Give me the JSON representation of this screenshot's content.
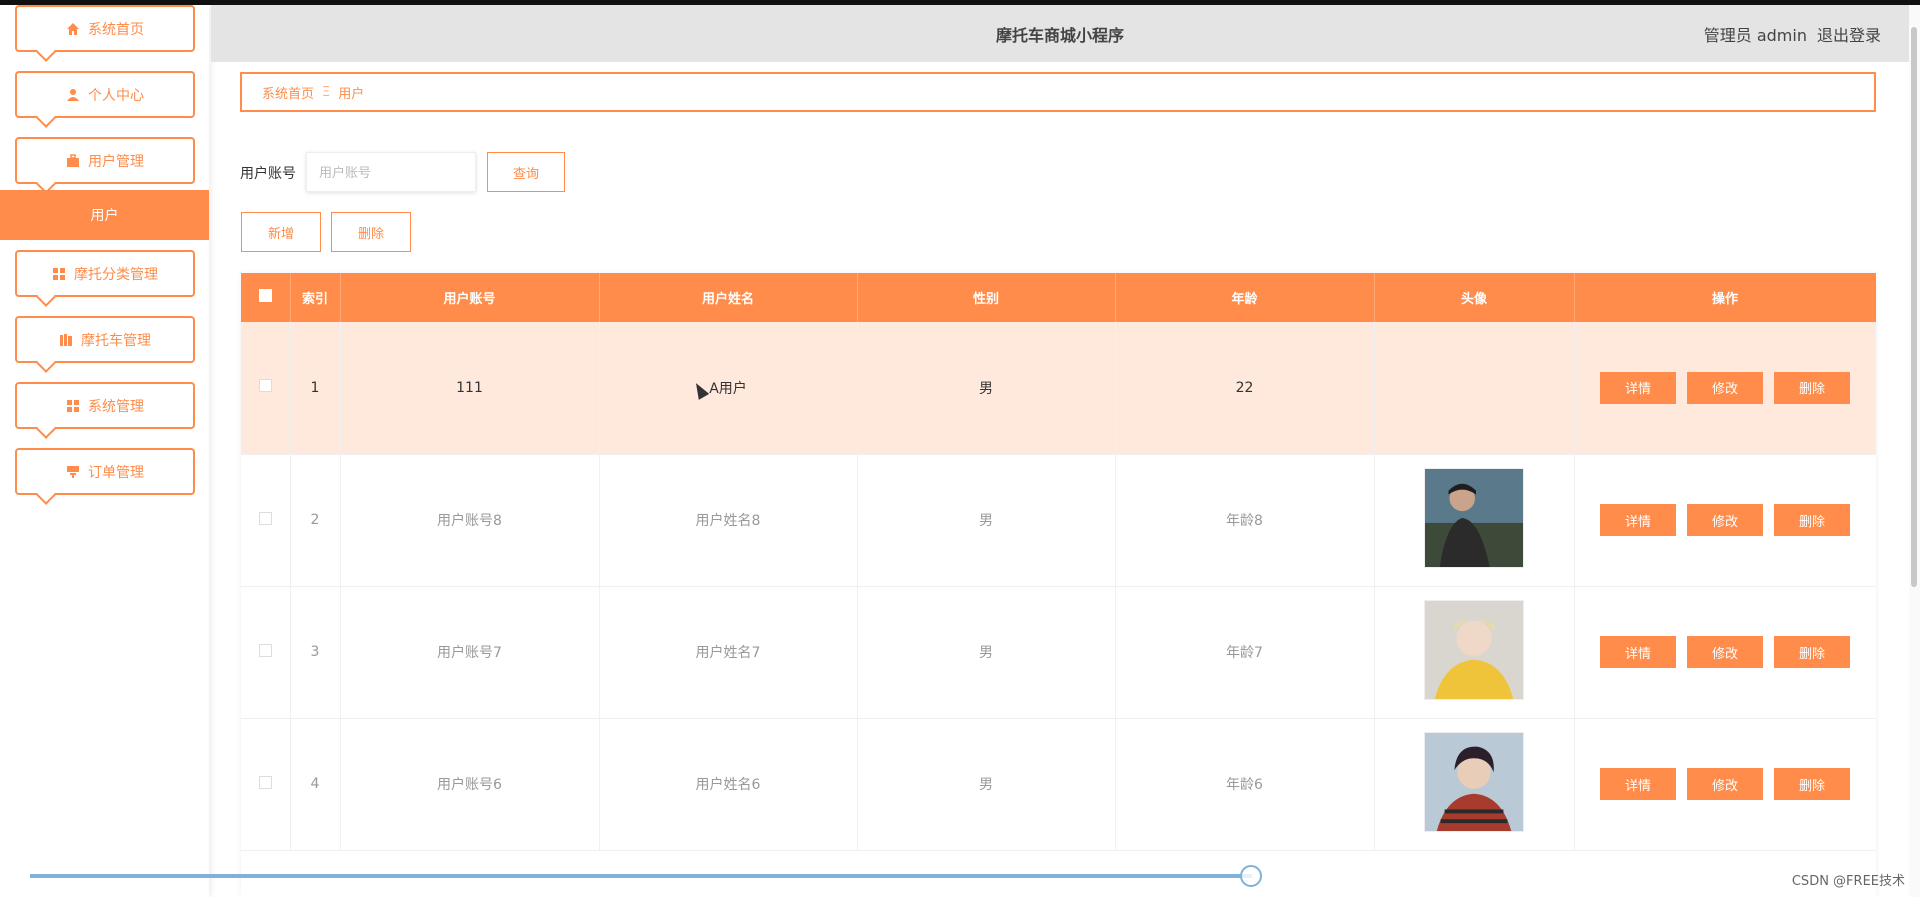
{
  "app": {
    "title": "摩托车商城小程序",
    "user_role": "管理员",
    "username": "admin",
    "logout": "退出登录"
  },
  "colors": {
    "accent": "#ff8c4a",
    "header_bg": "#e4e4e4",
    "row_highlight": "#ffe9dd"
  },
  "sidebar": {
    "items": [
      {
        "label": "系统首页",
        "icon": "home-icon"
      },
      {
        "label": "个人中心",
        "icon": "user-icon"
      },
      {
        "label": "用户管理",
        "icon": "briefcase-icon"
      },
      {
        "label": "用户",
        "icon": "",
        "active": true
      },
      {
        "label": "摩托分类管理",
        "icon": "grid-icon"
      },
      {
        "label": "摩托车管理",
        "icon": "books-icon"
      },
      {
        "label": "系统管理",
        "icon": "grid-icon"
      },
      {
        "label": "订单管理",
        "icon": "cart-icon"
      }
    ]
  },
  "breadcrumb": {
    "home": "系统首页",
    "separator": "Ξ",
    "current": "用户"
  },
  "search": {
    "label": "用户账号",
    "placeholder": "用户账号",
    "value": "",
    "query_button": "查询"
  },
  "actions": {
    "add": "新增",
    "delete": "删除"
  },
  "table": {
    "columns": [
      "索引",
      "用户账号",
      "用户姓名",
      "性别",
      "年龄",
      "头像",
      "操作"
    ],
    "rows": [
      {
        "index": "1",
        "account": "111",
        "name": "A用户",
        "gender": "男",
        "age": "22",
        "avatar": ""
      },
      {
        "index": "2",
        "account": "用户账号8",
        "name": "用户姓名8",
        "gender": "男",
        "age": "年龄8",
        "avatar": "photo"
      },
      {
        "index": "3",
        "account": "用户账号7",
        "name": "用户姓名7",
        "gender": "男",
        "age": "年龄7",
        "avatar": "photo"
      },
      {
        "index": "4",
        "account": "用户账号6",
        "name": "用户姓名6",
        "gender": "男",
        "age": "年龄6",
        "avatar": "photo"
      }
    ],
    "row_actions": {
      "detail": "详情",
      "edit": "修改",
      "delete": "删除"
    }
  },
  "watermark": "CSDN @FREE技术"
}
